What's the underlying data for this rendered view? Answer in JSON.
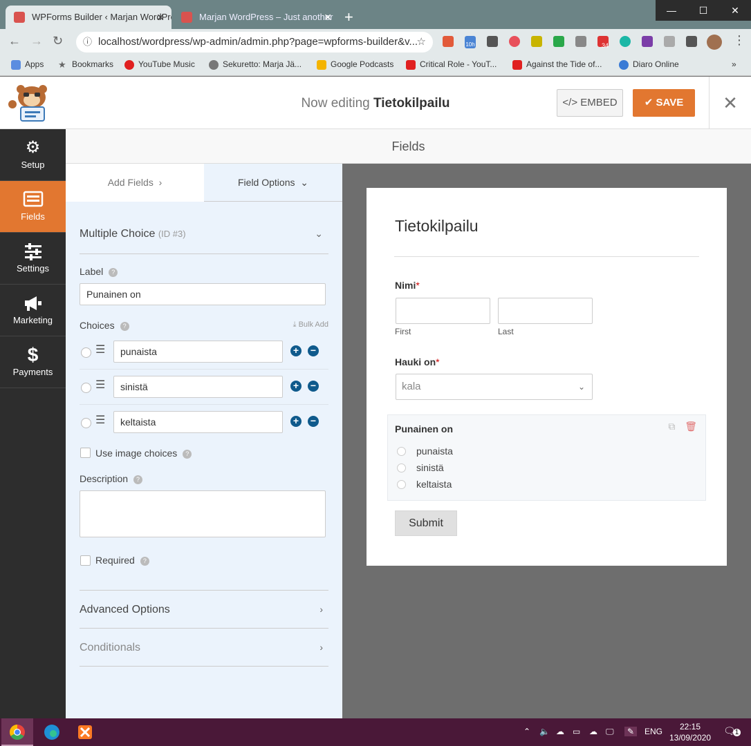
{
  "browser": {
    "tabs": [
      {
        "title": "WPForms Builder ‹ Marjan WordPress",
        "active": true
      },
      {
        "title": "Marjan WordPress – Just another",
        "active": false
      }
    ],
    "new_tab": "+",
    "window_controls": {
      "minimize": "—",
      "maximize": "☐",
      "close": "✕"
    },
    "url": "localhost/wordpress/wp-admin/admin.php?page=wpforms-builder&v...",
    "extension_badges": {
      "calendar": "10h",
      "todoist": "34"
    },
    "bookmarks": [
      {
        "label": "Apps",
        "icon": "apps-icon"
      },
      {
        "label": "Bookmarks",
        "icon": "star-icon"
      },
      {
        "label": "YouTube Music",
        "icon": "youtube-music-icon"
      },
      {
        "label": "Sekuretto: Marja Jä...",
        "icon": "globe-icon"
      },
      {
        "label": "Google Podcasts",
        "icon": "podcasts-icon"
      },
      {
        "label": "Critical Role - YouT...",
        "icon": "youtube-icon"
      },
      {
        "label": "Against the Tide of...",
        "icon": "youtube-icon"
      },
      {
        "label": "Diaro Online",
        "icon": "diaro-icon"
      }
    ],
    "bookmarks_more": "»"
  },
  "header": {
    "editing_prefix": "Now editing",
    "form_name": "Tietokilpailu",
    "embed_label": "EMBED",
    "save_label": "SAVE",
    "close_icon": "✕"
  },
  "sidebar": {
    "items": [
      {
        "label": "Setup",
        "icon": "gear-icon"
      },
      {
        "label": "Fields",
        "icon": "fields-icon",
        "active": true
      },
      {
        "label": "Settings",
        "icon": "sliders-icon"
      },
      {
        "label": "Marketing",
        "icon": "megaphone-icon"
      },
      {
        "label": "Payments",
        "icon": "dollar-icon"
      }
    ]
  },
  "fields_bar": {
    "title": "Fields"
  },
  "panel": {
    "tabs": {
      "add_fields": "Add Fields",
      "field_options": "Field Options"
    },
    "field_type": "Multiple Choice",
    "field_id": "(ID #3)",
    "label_label": "Label",
    "label_value": "Punainen on",
    "choices_label": "Choices",
    "bulk_add": "Bulk Add",
    "choices": [
      "punaista",
      "sinistä",
      "keltaista"
    ],
    "use_image_choices": "Use image choices",
    "description_label": "Description",
    "required_label": "Required",
    "advanced_options": "Advanced Options",
    "conditionals": "Conditionals"
  },
  "preview": {
    "title": "Tietokilpailu",
    "name_label": "Nimi",
    "required_mark": "*",
    "first_label": "First",
    "last_label": "Last",
    "select_label": "Hauki on",
    "select_value": "kala",
    "mc_label": "Punainen on",
    "mc_options": [
      "punaista",
      "sinistä",
      "keltaista"
    ],
    "submit_label": "Submit"
  },
  "taskbar": {
    "language": "ENG",
    "time": "22:15",
    "date": "13/09/2020",
    "notifications": "1"
  },
  "colors": {
    "accent": "#e27730",
    "nav_bg": "#2d2d2d",
    "panel_bg": "#ebf3fc",
    "choice_btn": "#0f5a8c",
    "taskbar": "#4a1838"
  }
}
